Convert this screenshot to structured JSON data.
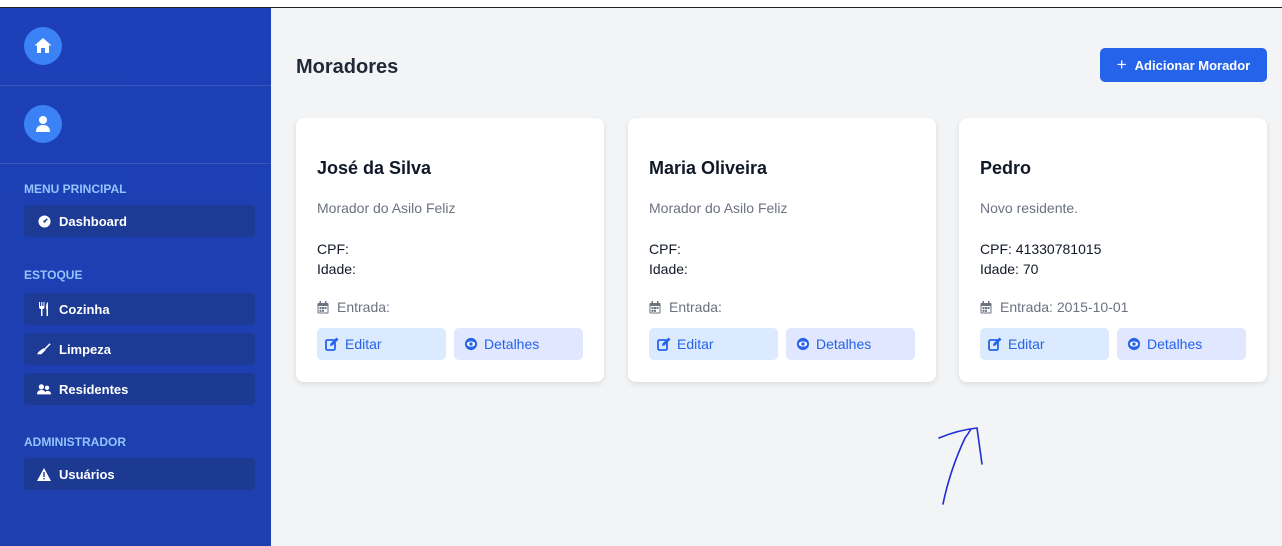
{
  "sidebar": {
    "home_icon": "home-icon",
    "user_icon": "user-icon",
    "sections": [
      {
        "title": "MENU PRINCIPAL",
        "items": [
          {
            "label": "Dashboard",
            "icon": "gauge-icon"
          }
        ]
      },
      {
        "title": "ESTOQUE",
        "items": [
          {
            "label": "Cozinha",
            "icon": "utensils-icon"
          },
          {
            "label": "Limpeza",
            "icon": "broom-icon"
          },
          {
            "label": "Residentes",
            "icon": "users-icon"
          }
        ]
      },
      {
        "title": "ADMINISTRADOR",
        "items": [
          {
            "label": "Usuários",
            "icon": "warning-icon"
          }
        ]
      }
    ]
  },
  "main": {
    "title": "Moradores",
    "add_button": "Adicionar Morador",
    "cards": [
      {
        "name": "José da Silva",
        "description": "Morador do Asilo Feliz",
        "cpf": "CPF:",
        "idade": "Idade:",
        "entrada": "Entrada:",
        "edit_label": "Editar",
        "details_label": "Detalhes"
      },
      {
        "name": "Maria Oliveira",
        "description": "Morador do Asilo Feliz",
        "cpf": "CPF:",
        "idade": "Idade:",
        "entrada": "Entrada:",
        "edit_label": "Editar",
        "details_label": "Detalhes"
      },
      {
        "name": "Pedro",
        "description": "Novo residente.",
        "cpf": "CPF: 41330781015",
        "idade": "Idade: 70",
        "entrada": "Entrada: 2015-10-01",
        "edit_label": "Editar",
        "details_label": "Detalhes"
      }
    ]
  },
  "colors": {
    "sidebar_bg": "#1e3fae",
    "accent": "#2563eb",
    "section_title": "#93c5fd",
    "annotation_ink": "#1f2ed6"
  }
}
